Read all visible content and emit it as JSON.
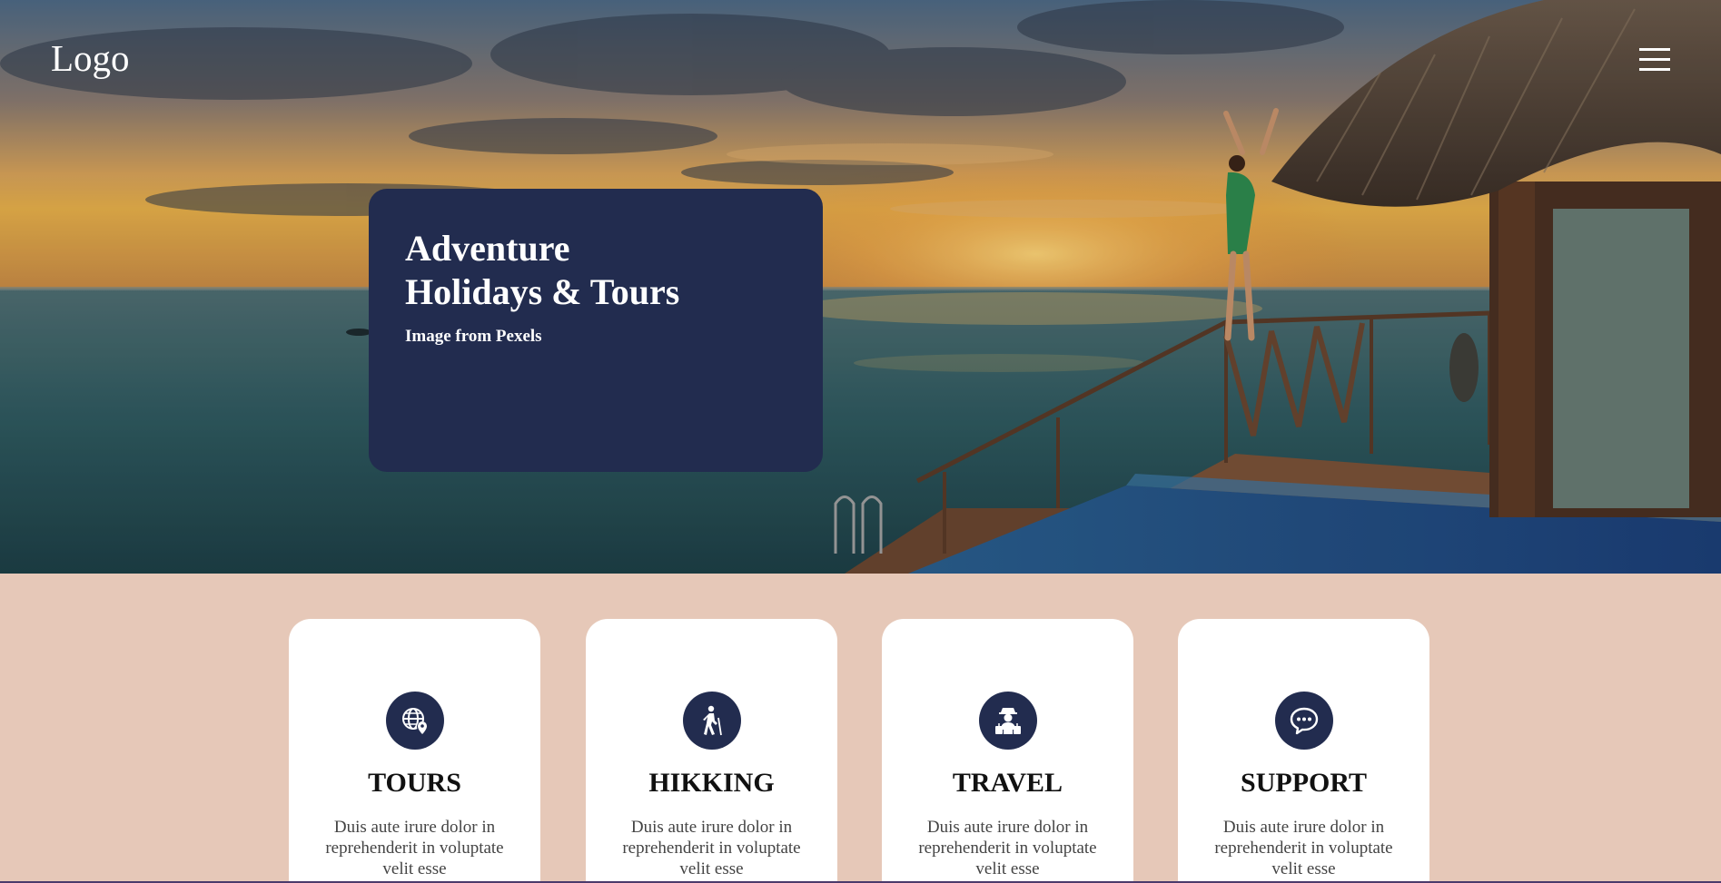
{
  "header": {
    "logo": "Logo",
    "menu_icon": "hamburger-menu-icon"
  },
  "hero": {
    "title_line1": "Adventure",
    "title_line2": "Holidays & Tours",
    "credit": "Image from Pexels",
    "card_color": "#222c4f"
  },
  "features": {
    "background_color": "#e6c8b8",
    "cards": [
      {
        "icon": "globe-location-icon",
        "title": "TOURS",
        "text": "Duis aute irure dolor in reprehenderit in voluptate velit esse"
      },
      {
        "icon": "hiker-icon",
        "title": "HIKKING",
        "text": "Duis aute irure dolor in reprehenderit in voluptate velit esse"
      },
      {
        "icon": "traveler-luggage-icon",
        "title": "TRAVEL",
        "text": "Duis aute irure dolor in reprehenderit in voluptate velit esse"
      },
      {
        "icon": "chat-bubble-icon",
        "title": "SUPPORT",
        "text": "Duis aute irure dolor in reprehenderit in voluptate velit esse"
      }
    ]
  }
}
